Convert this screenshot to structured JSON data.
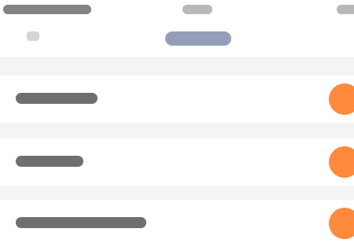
{
  "colors": {
    "background": "#f4f4f6",
    "surface": "#ffffff",
    "accent": "#ff8a3d",
    "pill": "#7b86a6",
    "text_placeholder": "#5f5f63"
  },
  "header": {
    "tabs": [
      {
        "label": ""
      },
      {
        "label": ""
      },
      {
        "label": ""
      }
    ],
    "subheader": {
      "left_label": "",
      "center_pill_label": ""
    }
  },
  "list": {
    "items": [
      {
        "label": "",
        "toggle_state": "on"
      },
      {
        "label": "",
        "toggle_state": "on"
      },
      {
        "label": "",
        "toggle_state": "on"
      }
    ]
  }
}
